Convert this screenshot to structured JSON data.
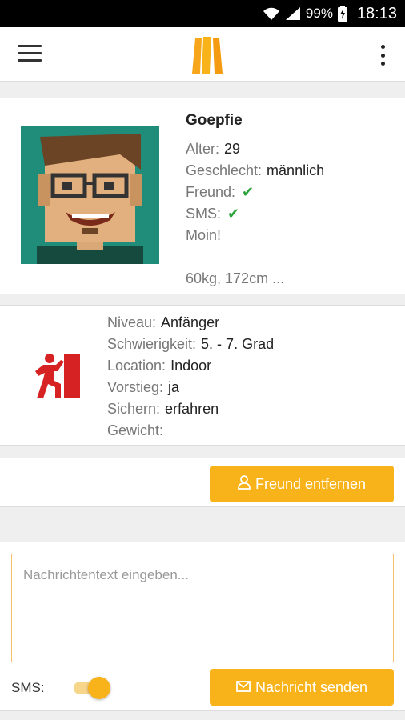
{
  "status_bar": {
    "battery": "99%",
    "time": "18:13"
  },
  "colors": {
    "accent": "#f9b31a",
    "check": "#2aa33a",
    "climber": "#d62222"
  },
  "profile": {
    "name": "Goepfie",
    "fields": [
      {
        "label": "Alter:",
        "value": "29"
      },
      {
        "label": "Geschlecht:",
        "value": "männlich"
      },
      {
        "label": "Freund:",
        "value": "✔"
      },
      {
        "label": "SMS:",
        "value": "✔"
      }
    ],
    "status": "Moin!",
    "bio": "60kg, 172cm ..."
  },
  "climbing": {
    "fields": [
      {
        "label": "Niveau:",
        "value": "Anfänger"
      },
      {
        "label": "Schwierigkeit:",
        "value": "5. - 7. Grad"
      },
      {
        "label": "Location:",
        "value": "Indoor"
      },
      {
        "label": "Vorstieg:",
        "value": "ja"
      },
      {
        "label": "Sichern:",
        "value": "erfahren"
      },
      {
        "label": "Gewicht:",
        "value": ""
      }
    ]
  },
  "actions": {
    "remove_friend_label": "Freund entfernen"
  },
  "message": {
    "placeholder": "Nachrichtentext eingeben...",
    "sms_label": "SMS:",
    "sms_enabled": true,
    "send_label": "Nachricht senden"
  }
}
